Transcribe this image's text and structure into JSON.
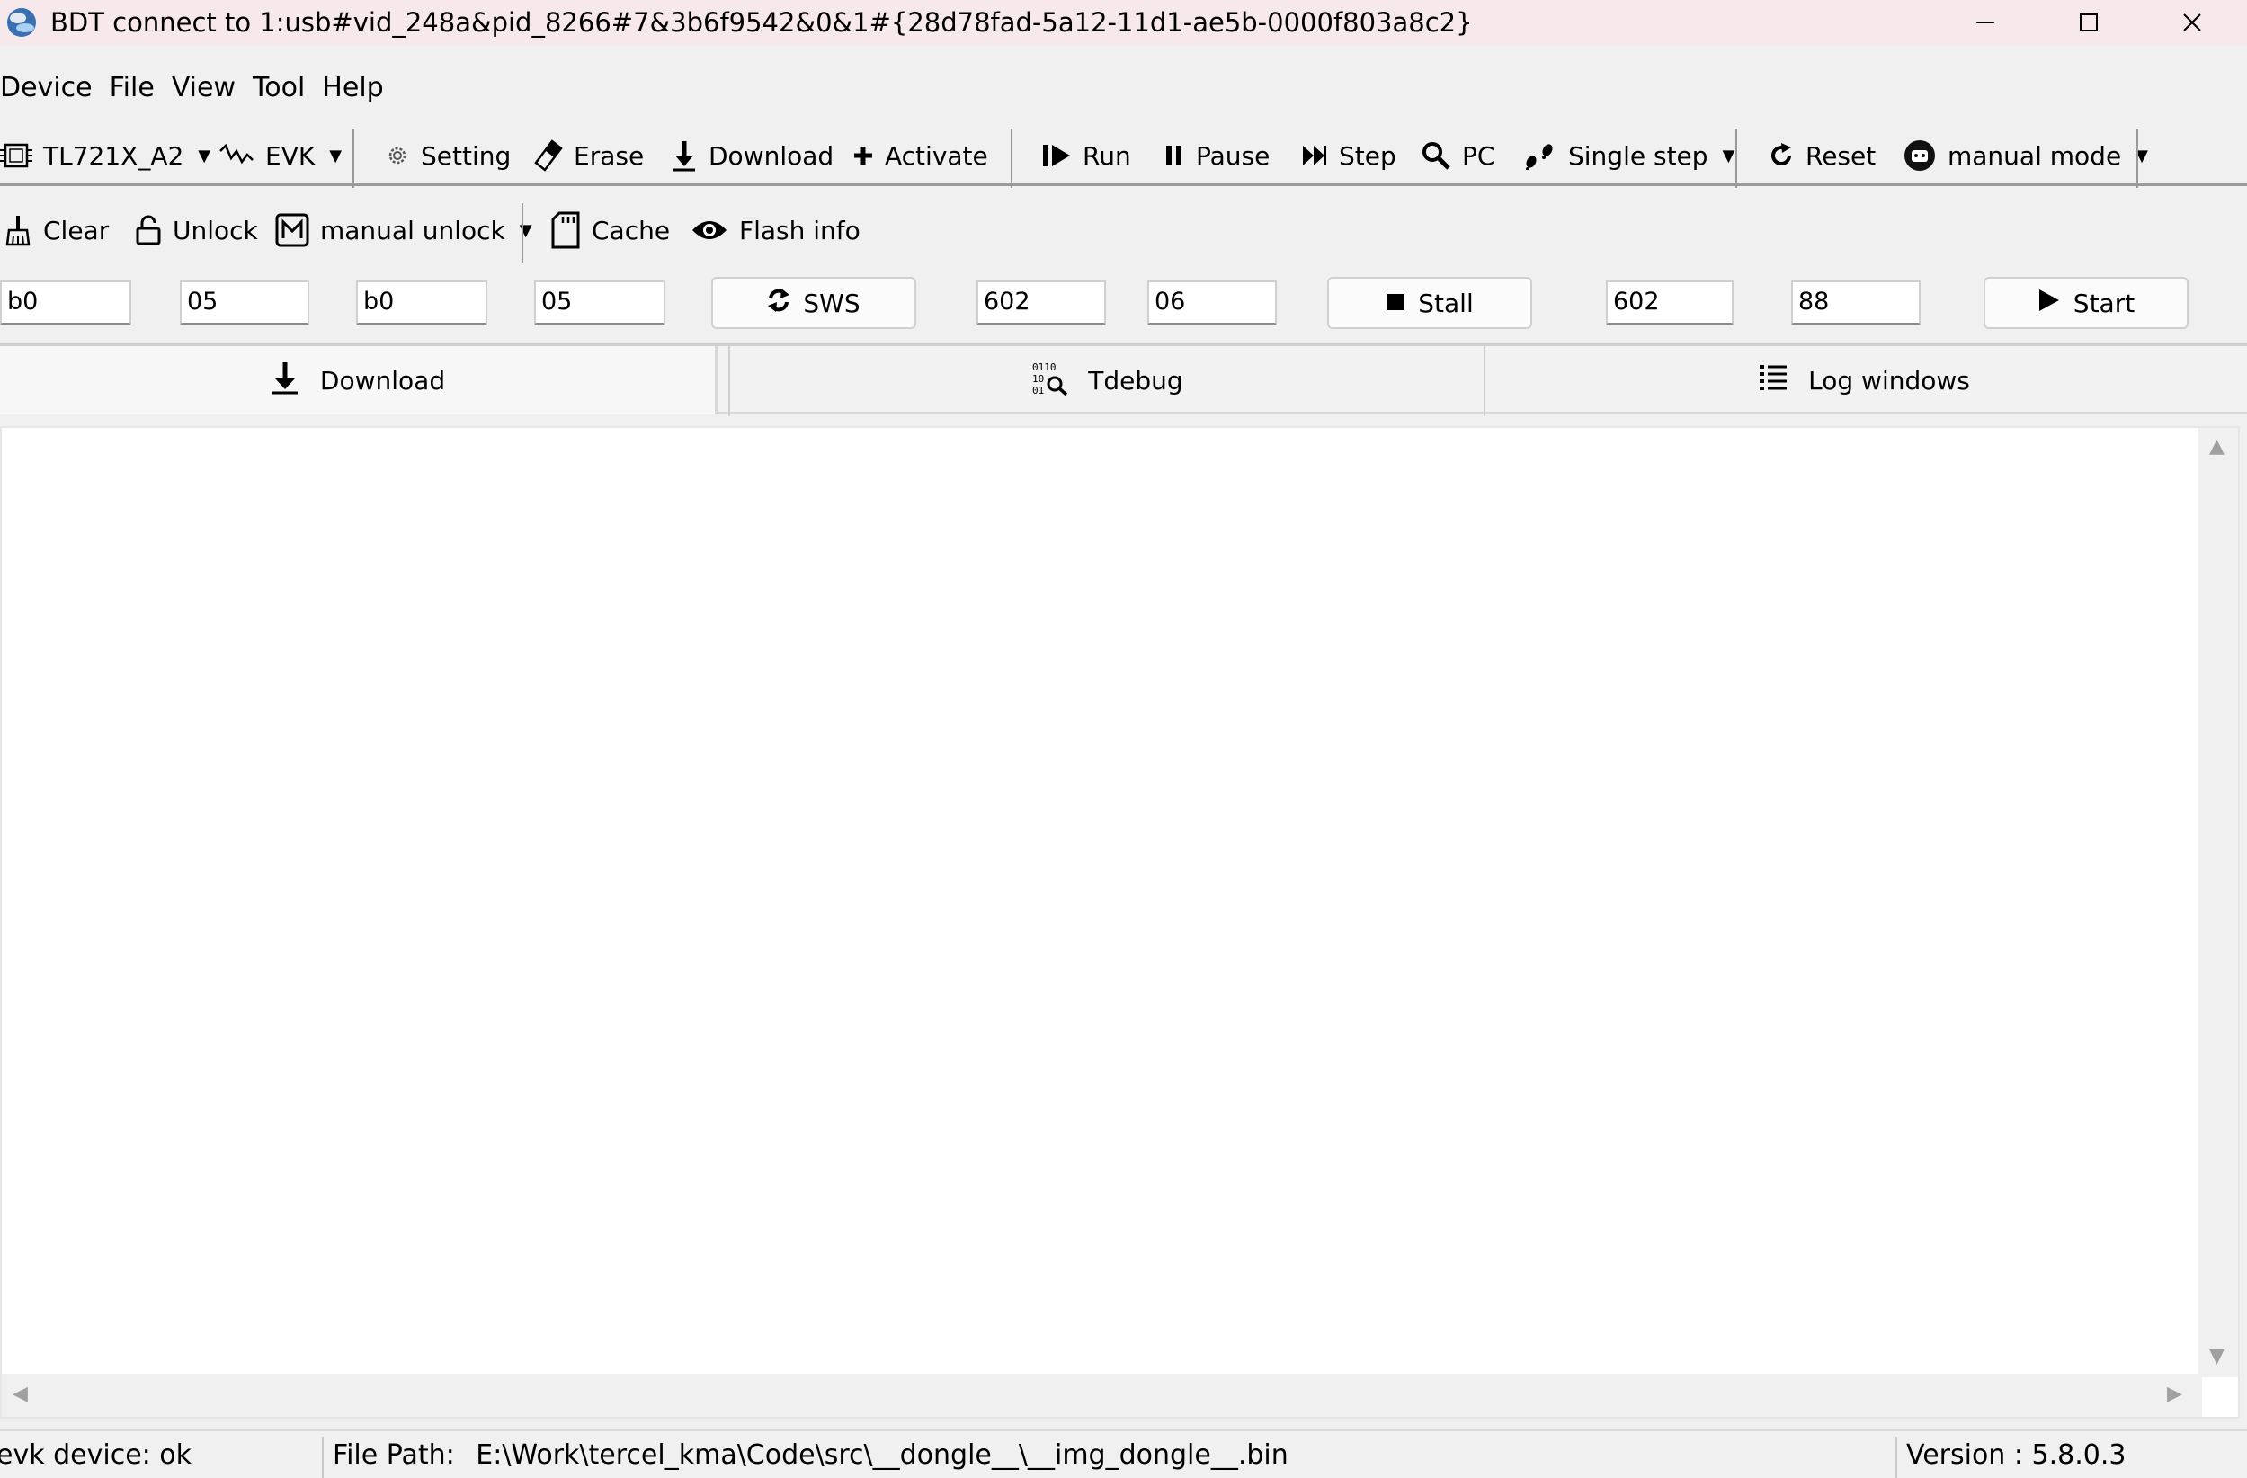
{
  "window": {
    "title": "BDT connect to 1:usb#vid_248a&pid_8266#7&3b6f9542&0&1#{28d78fad-5a12-11d1-ae5b-0000f803a8c2}"
  },
  "menubar": {
    "items": [
      "Device",
      "File",
      "View",
      "Tool",
      "Help"
    ]
  },
  "toolbar1": {
    "chip": "TL721X_A2",
    "board": "EVK",
    "setting": "Setting",
    "erase": "Erase",
    "download": "Download",
    "activate": "Activate",
    "run": "Run",
    "pause": "Pause",
    "step": "Step",
    "pc": "PC",
    "single_step": "Single step",
    "reset": "Reset",
    "mode": "manual mode"
  },
  "toolbar2": {
    "clear": "Clear",
    "unlock": "Unlock",
    "manual_unlock": "manual unlock",
    "cache": "Cache",
    "flash_info": "Flash info"
  },
  "fields": {
    "f1": "b0",
    "f2": "05",
    "f3": "b0",
    "f4": "05",
    "sws": "SWS",
    "f5": "602",
    "f6": "06",
    "stall": "Stall",
    "f7": "602",
    "f8": "88",
    "start": "Start"
  },
  "tabs": [
    "Download",
    "Tdebug",
    "Log windows"
  ],
  "status": {
    "device": "evk device: ok",
    "file_path_label": "File Path:",
    "file_path": "E:\\Work\\tercel_kma\\Code\\src\\__dongle__\\__img_dongle__.bin",
    "version": "Version : 5.8.0.3"
  },
  "colors": {
    "titlebar": "#f7e8ec",
    "background": "#f0f0f0",
    "content": "#ffffff"
  }
}
